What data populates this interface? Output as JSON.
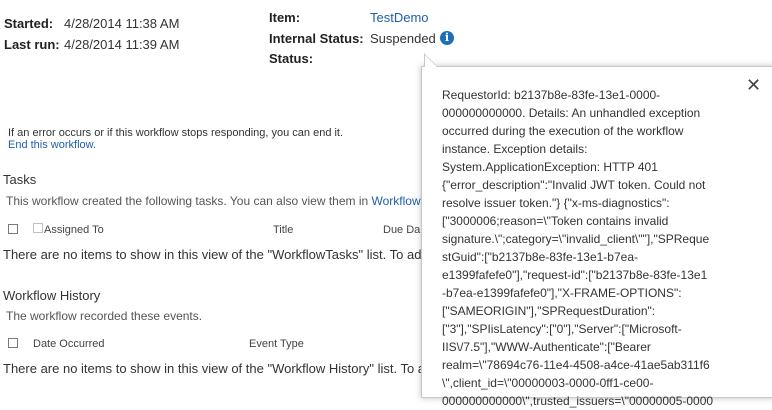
{
  "summary": {
    "started_label": "Started:",
    "started_value": "4/28/2014 11:38 AM",
    "lastrun_label": "Last run:",
    "lastrun_value": "4/28/2014 11:39 AM",
    "item_label": "Item:",
    "item_value": "TestDemo",
    "internal_status_label": "Internal Status:",
    "internal_status_value": "Suspended",
    "status_label": "Status:"
  },
  "end_workflow": {
    "note": "If an error occurs or if this workflow stops responding, you can end it.",
    "link": "End this workflow."
  },
  "tasks": {
    "heading": "Tasks",
    "description": "This workflow created the following tasks. You can also view them in ",
    "description_link": "WorkflowTa",
    "columns": [
      "Assigned To",
      "Title",
      "Due Da"
    ],
    "empty": "There are no items to show in this view of the \"WorkflowTasks\" list. To ad"
  },
  "history": {
    "heading": "Workflow History",
    "description": "The workflow recorded these events.",
    "columns": [
      "Date Occurred",
      "Event Type"
    ],
    "empty": "There are no items to show in this view of the \"Workflow History\" list. To a"
  },
  "callout": {
    "close": "✕",
    "text": "RequestorId: b2137b8e-83fe-13e1-0000-\n000000000000. Details: An unhandled exception\noccurred during the execution of the workflow\ninstance. Exception details:\nSystem.ApplicationException: HTTP 401\n{\"error_description\":\"Invalid JWT token. Could not\nresolve issuer token.\"} {\"x-ms-diagnostics\":\n[\"3000006;reason=\\\"Token contains invalid\nsignature.\\\";category=\\\"invalid_client\\\"\"],\"SPReque\nstGuid\":[\"b2137b8e-83fe-13e1-b7ea-\ne1399fafefe0\"],\"request-id\":[\"b2137b8e-83fe-13e1\n-b7ea-e1399fafefe0\"],\"X-FRAME-OPTIONS\":\n[\"SAMEORIGIN\"],\"SPRequestDuration\":\n[\"3\"],\"SPIisLatency\":[\"0\"],\"Server\":[\"Microsoft-\nIIS\\/7.5\"],\"WWW-Authenticate\":[\"Bearer\nrealm=\\\"78694c76-11e4-4508-a4ce-41ae5ab311f6\n\\\",client_id=\\\"00000003-0000-0ff1-ce00-\n000000000000\\\",trusted_issuers=\\\"00000005-0000"
  },
  "icons": {
    "info": "i",
    "close": "close-icon"
  },
  "colors": {
    "link": "#1f5fa8",
    "info_icon": "#1f6fb8"
  }
}
